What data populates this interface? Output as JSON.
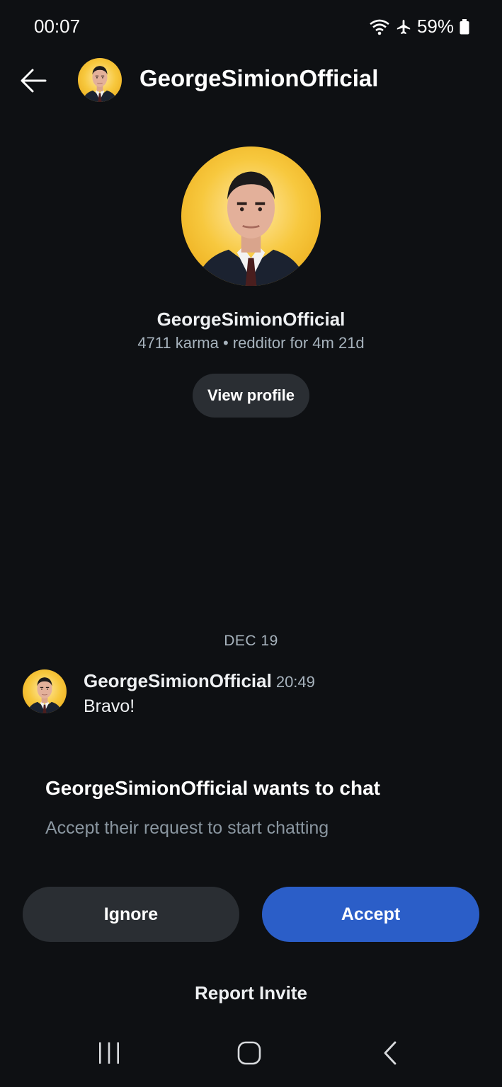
{
  "status_bar": {
    "time": "00:07",
    "battery": "59%",
    "icons": [
      "wifi-icon",
      "airplane-icon",
      "battery-icon"
    ]
  },
  "header": {
    "title": "GeorgeSimionOfficial",
    "back_icon": "arrow-left-icon"
  },
  "profile": {
    "name": "GeorgeSimionOfficial",
    "meta": "4711 karma • redditor for 4m 21d",
    "view_profile_label": "View profile"
  },
  "conversation": {
    "date": "DEC 19",
    "messages": [
      {
        "author": "GeorgeSimionOfficial",
        "time": "20:49",
        "text": "Bravo!"
      }
    ]
  },
  "request": {
    "title": "GeorgeSimionOfficial wants to chat",
    "subtitle": "Accept their request to start chatting",
    "ignore_label": "Ignore",
    "accept_label": "Accept",
    "report_label": "Report Invite"
  },
  "colors": {
    "background": "#0e1013",
    "accent": "#2b5ec8",
    "secondary_button": "#2a2e33",
    "avatar_background": "#f5c131"
  }
}
